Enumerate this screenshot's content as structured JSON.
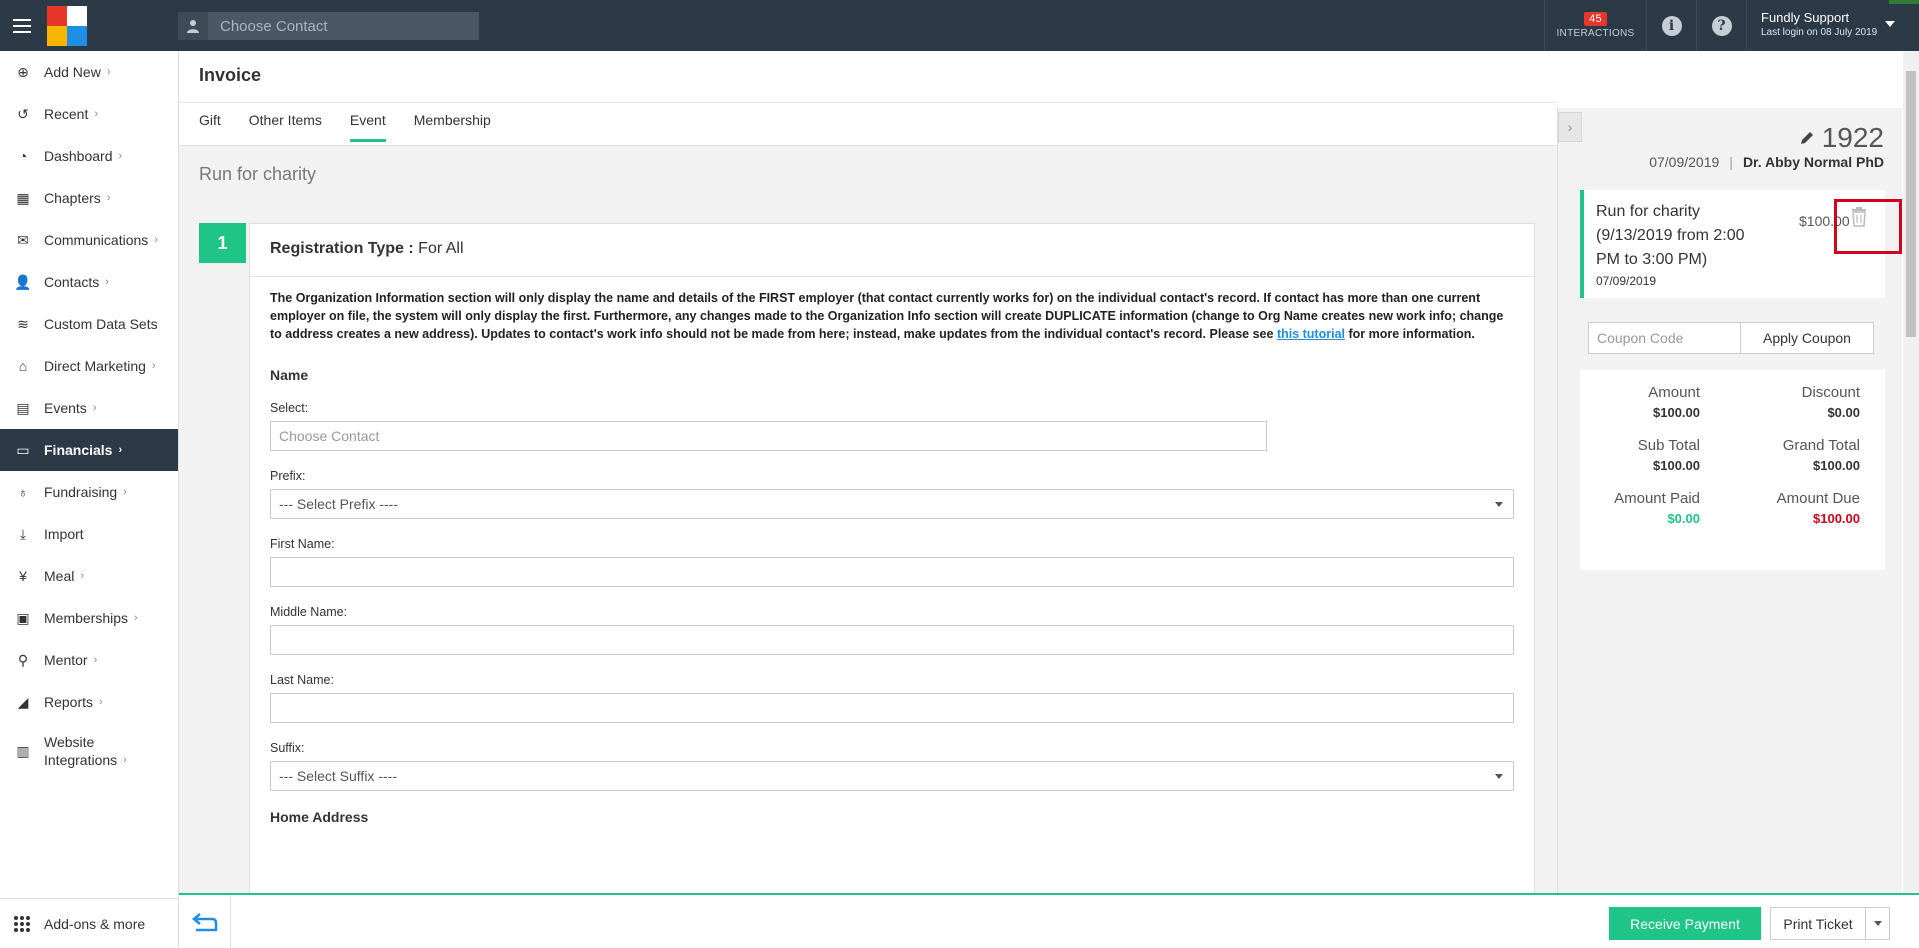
{
  "topbar": {
    "search_placeholder": "Choose Contact",
    "interactions_count": "45",
    "interactions_label": "INTERACTIONS",
    "user_name": "Fundly Support",
    "last_login": "Last login on 08 July 2019"
  },
  "sidebar": {
    "items": [
      {
        "label": "Add New",
        "icon": "plus-circle-icon",
        "chev": true
      },
      {
        "label": "Recent",
        "icon": "history-icon",
        "chev": true
      },
      {
        "label": "Dashboard",
        "icon": "dashboard-icon",
        "chev": true
      },
      {
        "label": "Chapters",
        "icon": "grid-icon",
        "chev": true
      },
      {
        "label": "Communications",
        "icon": "envelope-icon",
        "chev": true
      },
      {
        "label": "Contacts",
        "icon": "user-icon",
        "chev": true
      },
      {
        "label": "Custom Data Sets",
        "icon": "layers-icon",
        "chev": false
      },
      {
        "label": "Direct Marketing",
        "icon": "store-icon",
        "chev": true
      },
      {
        "label": "Events",
        "icon": "calendar-icon",
        "chev": true
      },
      {
        "label": "Financials",
        "icon": "money-icon",
        "chev": true
      },
      {
        "label": "Fundraising",
        "icon": "moneybag-icon",
        "chev": true
      },
      {
        "label": "Import",
        "icon": "download-icon",
        "chev": false
      },
      {
        "label": "Meal",
        "icon": "cutlery-icon",
        "chev": true
      },
      {
        "label": "Memberships",
        "icon": "id-card-icon",
        "chev": true
      },
      {
        "label": "Mentor",
        "icon": "running-icon",
        "chev": true
      },
      {
        "label": "Reports",
        "icon": "area-chart-icon",
        "chev": true
      },
      {
        "label_line1": "Website",
        "label_line2": "Integrations",
        "icon": "browser-icon",
        "chev": true
      }
    ],
    "bottom_label": "Add-ons & more"
  },
  "main": {
    "title": "Invoice",
    "tabs": [
      "Gift",
      "Other Items",
      "Event",
      "Membership"
    ],
    "active_tab": "Event",
    "content_title": "Run for charity",
    "step_number": "1",
    "registration_type_label": "Registration Type :",
    "registration_type_value": "For All",
    "note_text": "The Organization Information section will only display the name and details of the FIRST employer (that contact currently works for) on the individual contact's record. If contact has more than one current employer on file, the system will only display the first. Furthermore, any changes made to the Organization Info section will create DUPLICATE information (change to Org Name creates new work info; change to address creates a new address). Updates to contact's work info should not be made from here; instead, make updates from the individual contact's record. Please see",
    "note_link": "this tutorial",
    "note_tail": "for more information.",
    "name_section": "Name",
    "select_label": "Select:",
    "select_placeholder": "Choose Contact",
    "prefix_label": "Prefix:",
    "prefix_value": "--- Select Prefix ----",
    "first_name_label": "First Name:",
    "middle_name_label": "Middle Name:",
    "last_name_label": "Last Name:",
    "suffix_label": "Suffix:",
    "suffix_value": "--- Select Suffix ----",
    "home_address_section": "Home Address"
  },
  "right_panel": {
    "invoice_number": "1922",
    "date": "07/09/2019",
    "contact": "Dr. Abby Normal PhD",
    "item_name": "Run for charity (9/13/2019 from 2:00 PM to 3:00 PM)",
    "item_date": "07/09/2019",
    "item_price": "$100.00",
    "coupon_placeholder": "Coupon Code",
    "apply_coupon": "Apply Coupon",
    "totals": {
      "amount_label": "Amount",
      "amount": "$100.00",
      "discount_label": "Discount",
      "discount": "$0.00",
      "subtotal_label": "Sub Total",
      "subtotal": "$100.00",
      "grandtotal_label": "Grand Total",
      "grandtotal": "$100.00",
      "paid_label": "Amount Paid",
      "paid": "$0.00",
      "due_label": "Amount Due",
      "due": "$100.00"
    }
  },
  "bottom_bar": {
    "receive_payment": "Receive Payment",
    "print_ticket": "Print Ticket"
  },
  "colors": {
    "topbar": "#2c3a47",
    "accent_green": "#1fc586",
    "link_blue": "#1f8fe6",
    "due_red": "#d0021b"
  }
}
